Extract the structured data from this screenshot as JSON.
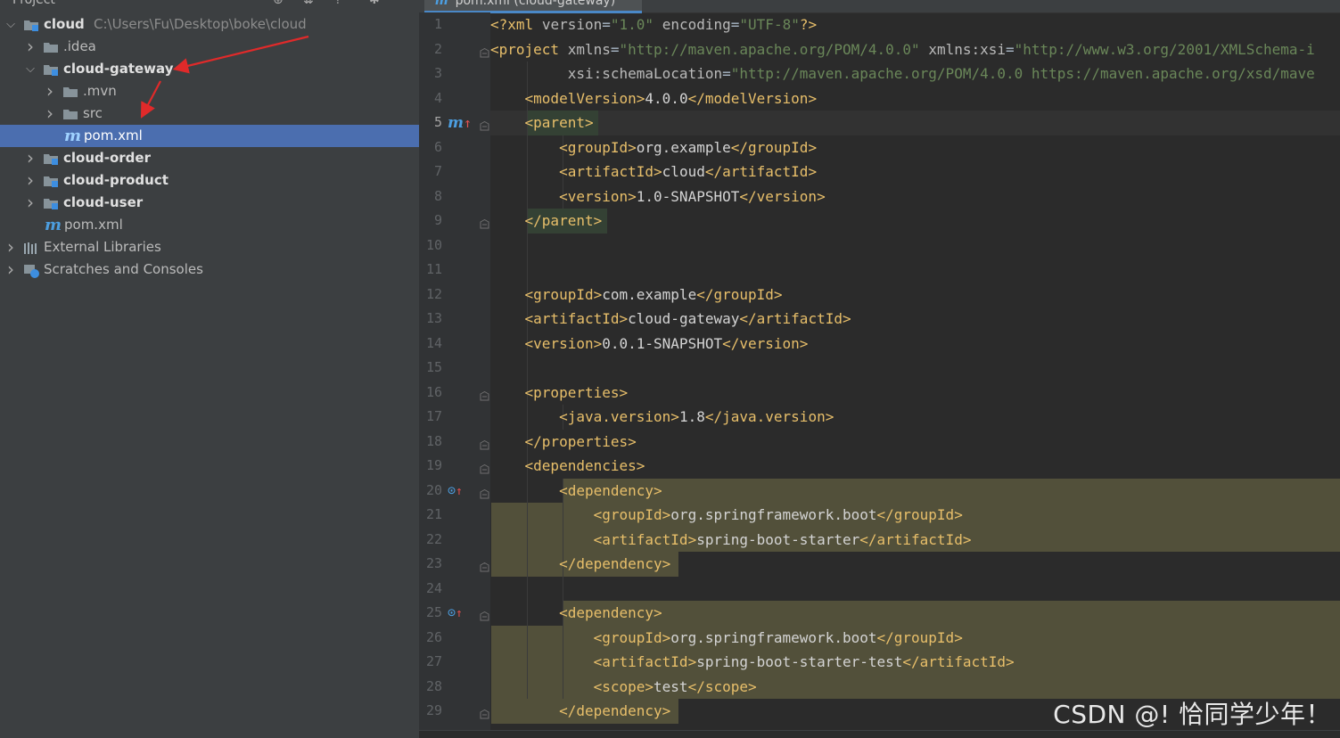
{
  "panel": {
    "title": "Project",
    "header_icons": [
      "add-icon",
      "collapse-icon",
      "expand-icon",
      "settings-icon"
    ]
  },
  "tree": [
    {
      "label": "cloud",
      "path": "C:\\Users\\Fu\\Desktop\\boke\\cloud",
      "indent": 0,
      "arrow": "down",
      "icon": "module-folder-icon",
      "bold": true
    },
    {
      "label": ".idea",
      "indent": 1,
      "arrow": "right",
      "icon": "folder-icon",
      "bold": false
    },
    {
      "label": "cloud-gateway",
      "indent": 1,
      "arrow": "down",
      "icon": "module-folder-icon",
      "bold": true
    },
    {
      "label": ".mvn",
      "indent": 2,
      "arrow": "right",
      "icon": "folder-icon",
      "bold": false
    },
    {
      "label": "src",
      "indent": 2,
      "arrow": "right",
      "icon": "folder-icon",
      "bold": false
    },
    {
      "label": "pom.xml",
      "indent": 2,
      "arrow": "none",
      "icon": "maven-icon",
      "bold": false,
      "selected": true
    },
    {
      "label": "cloud-order",
      "indent": 1,
      "arrow": "right",
      "icon": "module-folder-icon",
      "bold": true
    },
    {
      "label": "cloud-product",
      "indent": 1,
      "arrow": "right",
      "icon": "module-folder-icon",
      "bold": true
    },
    {
      "label": "cloud-user",
      "indent": 1,
      "arrow": "right",
      "icon": "module-folder-icon",
      "bold": true
    },
    {
      "label": "pom.xml",
      "indent": 1,
      "arrow": "none",
      "icon": "maven-icon",
      "bold": false
    },
    {
      "label": "External Libraries",
      "indent": 0,
      "arrow": "right",
      "icon": "library-icon",
      "bold": false
    },
    {
      "label": "Scratches and Consoles",
      "indent": 0,
      "arrow": "right",
      "icon": "scratches-icon",
      "bold": false
    }
  ],
  "editor": {
    "tab_label": "pom.xml (cloud-gateway)",
    "active_line": 5,
    "lines": [
      {
        "n": "1",
        "code": "<?xml version=\"1.0\" encoding=\"UTF-8\"?>"
      },
      {
        "n": "2",
        "code": "<project xmlns=\"http://maven.apache.org/POM/4.0.0\" xmlns:xsi=\"http://www.w3.org/2001/XMLSchema-i"
      },
      {
        "n": "3",
        "code": "         xsi:schemaLocation=\"http://maven.apache.org/POM/4.0.0 https://maven.apache.org/xsd/mave"
      },
      {
        "n": "4",
        "code": "    <modelVersion>4.0.0</modelVersion>"
      },
      {
        "n": "5",
        "code": "    <parent>"
      },
      {
        "n": "6",
        "code": "        <groupId>org.example</groupId>"
      },
      {
        "n": "7",
        "code": "        <artifactId>cloud</artifactId>"
      },
      {
        "n": "8",
        "code": "        <version>1.0-SNAPSHOT</version>"
      },
      {
        "n": "9",
        "code": "    </parent>"
      },
      {
        "n": "10",
        "code": ""
      },
      {
        "n": "11",
        "code": ""
      },
      {
        "n": "12",
        "code": "    <groupId>com.example</groupId>"
      },
      {
        "n": "13",
        "code": "    <artifactId>cloud-gateway</artifactId>"
      },
      {
        "n": "14",
        "code": "    <version>0.0.1-SNAPSHOT</version>"
      },
      {
        "n": "15",
        "code": ""
      },
      {
        "n": "16",
        "code": "    <properties>"
      },
      {
        "n": "17",
        "code": "        <java.version>1.8</java.version>"
      },
      {
        "n": "18",
        "code": "    </properties>"
      },
      {
        "n": "19",
        "code": "    <dependencies>"
      },
      {
        "n": "20",
        "code": "        <dependency>"
      },
      {
        "n": "21",
        "code": "            <groupId>org.springframework.boot</groupId>"
      },
      {
        "n": "22",
        "code": "            <artifactId>spring-boot-starter</artifactId>"
      },
      {
        "n": "23",
        "code": "        </dependency>"
      },
      {
        "n": "24",
        "code": ""
      },
      {
        "n": "25",
        "code": "        <dependency>"
      },
      {
        "n": "26",
        "code": "            <groupId>org.springframework.boot</groupId>"
      },
      {
        "n": "27",
        "code": "            <artifactId>spring-boot-starter-test</artifactId>"
      },
      {
        "n": "28",
        "code": "            <scope>test</scope>"
      },
      {
        "n": "29",
        "code": "        </dependency>"
      }
    ]
  },
  "gutter_icons": [
    {
      "line": 5,
      "name": "maven-parent-override-icon",
      "glyph": "m↑"
    },
    {
      "line": 20,
      "name": "maven-dependency-icon",
      "glyph": "⊙↑"
    },
    {
      "line": 25,
      "name": "maven-dependency-icon",
      "glyph": "⊙↑"
    }
  ],
  "colors": {
    "tag": "#e8bf6a",
    "selection": "#4b6eaf",
    "annotation_arrow": "#e02a2a",
    "dep_highlight": "#52503a"
  },
  "watermark": "CSDN @! 恰同学少年！"
}
